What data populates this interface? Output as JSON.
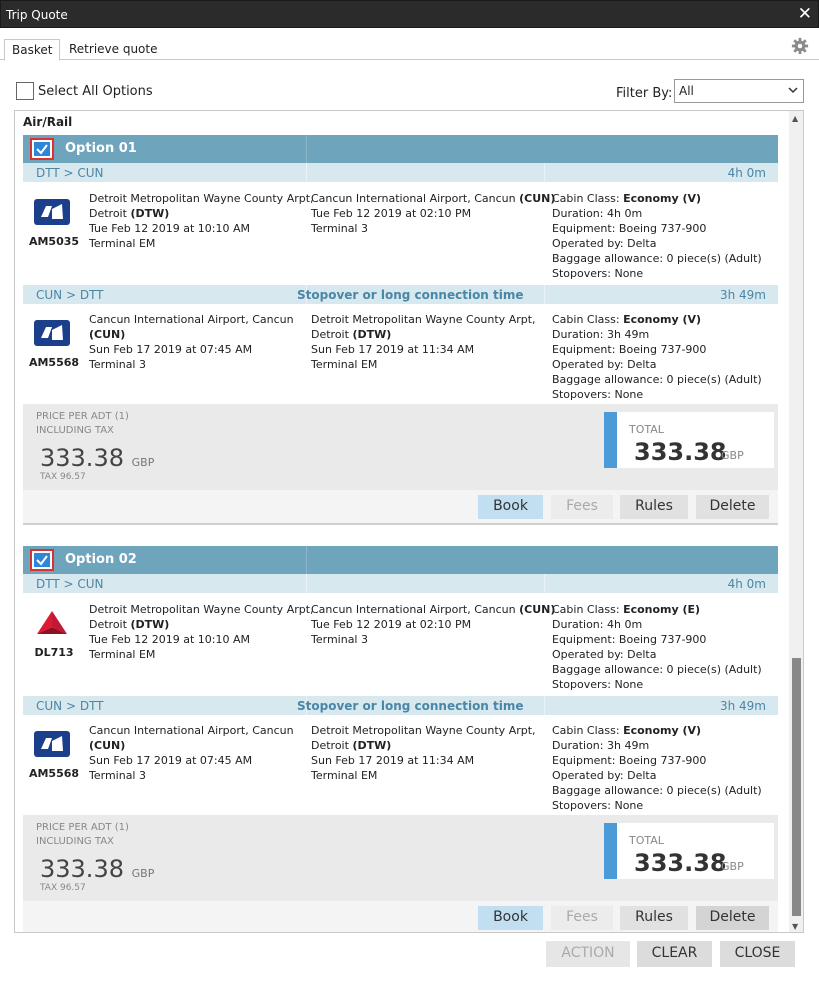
{
  "window": {
    "title": "Trip Quote",
    "close_glyph": "✕"
  },
  "tabs": [
    {
      "label": "Basket"
    },
    {
      "label": "Retrieve quote"
    }
  ],
  "toolbar": {
    "select_all_label": "Select All Options",
    "filter_label": "Filter By:",
    "filter_value": "All"
  },
  "section_title": "Air/Rail",
  "options": [
    {
      "title": "Option 01",
      "legs": [
        {
          "route": "DTT > CUN",
          "stopover": "",
          "duration": "4h 0m",
          "logo": "aeromexico-logo-icon",
          "flight": "AM5035",
          "dep": {
            "l1": "Detroit Metropolitan Wayne County Arpt,",
            "l2a": "Detroit ",
            "l2b": "(DTW)",
            "l3": "Tue Feb 12 2019 at 10:10 AM",
            "l4": "Terminal EM"
          },
          "arr": {
            "l1a": "Cancun International Airport, Cancun ",
            "l1b": "(CUN)",
            "l2": "Tue Feb 12 2019 at 02:10 PM",
            "l3": "Terminal 3"
          },
          "info": {
            "cabin_label": "Cabin Class: ",
            "cabin": "Economy (V)",
            "duration": "Duration:  4h 0m",
            "equipment": "Equipment: Boeing 737-900",
            "operated": "Operated by: Delta",
            "baggage": "Baggage allowance: 0 piece(s) (Adult)",
            "stopovers": "Stopovers: None"
          }
        },
        {
          "route": "CUN > DTT",
          "stopover": "Stopover or long connection time",
          "duration": "3h 49m",
          "logo": "aeromexico-logo-icon",
          "flight": "AM5568",
          "dep": {
            "l1": "Cancun International Airport, Cancun",
            "l2a": "",
            "l2b": "(CUN)",
            "l3": "Sun Feb 17 2019 at 07:45 AM",
            "l4": "Terminal 3"
          },
          "arr": {
            "l1a": "Detroit Metropolitan Wayne County Arpt,",
            "l1b": "",
            "l2a": "Detroit ",
            "l2b": "(DTW)",
            "l2": "Sun Feb 17 2019 at 11:34 AM",
            "l3": "Terminal EM"
          },
          "info": {
            "cabin_label": "Cabin Class: ",
            "cabin": "Economy (V)",
            "duration": "Duration:  3h 49m",
            "equipment": "Equipment: Boeing 737-900",
            "operated": "Operated by: Delta",
            "baggage": "Baggage allowance: 0 piece(s) (Adult)",
            "stopovers": "Stopovers: None"
          }
        }
      ],
      "price": {
        "l1": "PRICE PER ADT (1)",
        "l2": "INCLUDING TAX",
        "value": "333.38",
        "currency": "GBP",
        "tax": "TAX 96.57",
        "total_label": "TOTAL",
        "total": "333.38",
        "total_currency": "GBP"
      },
      "buttons": {
        "book": "Book",
        "fees": "Fees",
        "rules": "Rules",
        "delete": "Delete"
      }
    },
    {
      "title": "Option 02",
      "legs": [
        {
          "route": "DTT > CUN",
          "stopover": "",
          "duration": "4h 0m",
          "logo": "delta-logo-icon",
          "flight": "DL713",
          "dep": {
            "l1": "Detroit Metropolitan Wayne County Arpt,",
            "l2a": "Detroit ",
            "l2b": "(DTW)",
            "l3": "Tue Feb 12 2019 at 10:10 AM",
            "l4": "Terminal EM"
          },
          "arr": {
            "l1a": "Cancun International Airport, Cancun ",
            "l1b": "(CUN)",
            "l2": "Tue Feb 12 2019 at 02:10 PM",
            "l3": "Terminal 3"
          },
          "info": {
            "cabin_label": "Cabin Class: ",
            "cabin": "Economy (E)",
            "duration": "Duration:  4h 0m",
            "equipment": "Equipment: Boeing 737-900",
            "operated": "Operated by: Delta",
            "baggage": "Baggage allowance: 0 piece(s) (Adult)",
            "stopovers": "Stopovers: None"
          }
        },
        {
          "route": "CUN > DTT",
          "stopover": "Stopover or long connection time",
          "duration": "3h 49m",
          "logo": "aeromexico-logo-icon",
          "flight": "AM5568",
          "dep": {
            "l1": "Cancun International Airport, Cancun",
            "l2a": "",
            "l2b": "(CUN)",
            "l3": "Sun Feb 17 2019 at 07:45 AM",
            "l4": "Terminal 3"
          },
          "arr": {
            "l1a": "Detroit Metropolitan Wayne County Arpt,",
            "l1b": "",
            "l2a": "Detroit ",
            "l2b": "(DTW)",
            "l2": "Sun Feb 17 2019 at 11:34 AM",
            "l3": "Terminal EM"
          },
          "info": {
            "cabin_label": "Cabin Class: ",
            "cabin": "Economy (V)",
            "duration": "Duration:  3h 49m",
            "equipment": "Equipment: Boeing 737-900",
            "operated": "Operated by: Delta",
            "baggage": "Baggage allowance: 0 piece(s) (Adult)",
            "stopovers": "Stopovers: None"
          }
        }
      ],
      "price": {
        "l1": "PRICE PER ADT (1)",
        "l2": "INCLUDING TAX",
        "value": "333.38",
        "currency": "GBP",
        "tax": "TAX 96.57",
        "total_label": "TOTAL",
        "total": "333.38",
        "total_currency": "GBP"
      },
      "buttons": {
        "book": "Book",
        "fees": "Fees",
        "rules": "Rules",
        "delete": "Delete"
      }
    }
  ],
  "footer": {
    "action": "ACTION",
    "clear": "CLEAR",
    "close": "CLOSE"
  },
  "colors": {
    "header": "#6fa4bd",
    "leg_bar": "#d8e8ef",
    "accent": "#4a9bd8",
    "book": "#c2dff2"
  }
}
